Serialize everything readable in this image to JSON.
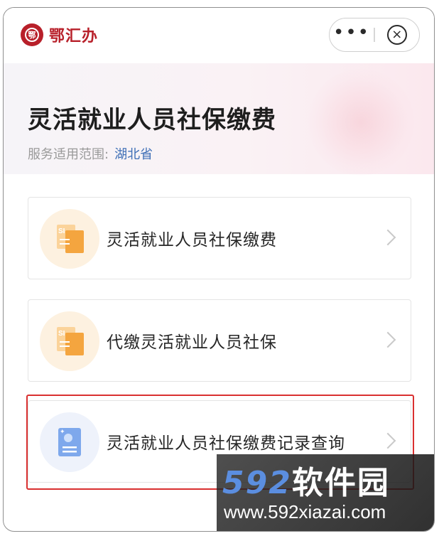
{
  "app": {
    "logo_text": "鄂汇办",
    "logo_mark": "鄂",
    "more_label": "•••",
    "close_label": "×"
  },
  "banner": {
    "title": "灵活就业人员社保缴费",
    "scope_label": "服务适用范围:",
    "scope_value": "湖北省"
  },
  "services": [
    {
      "label": "灵活就业人员社保缴费",
      "icon": "si-document-icon",
      "icon_color": "#f4a53f"
    },
    {
      "label": "代缴灵活就业人员社保",
      "icon": "si-document-icon",
      "icon_color": "#f4a53f"
    },
    {
      "label": "灵活就业人员社保缴费记录查询",
      "icon": "record-document-icon",
      "icon_color": "#7ea8ec"
    }
  ],
  "watermark": {
    "brand_num": "592",
    "brand_text": "软件园",
    "url": "www.592xiazai.com"
  },
  "colors": {
    "brand_red": "#b8202a",
    "accent_blue": "#3f6fb6",
    "highlight_red": "#d93030"
  }
}
